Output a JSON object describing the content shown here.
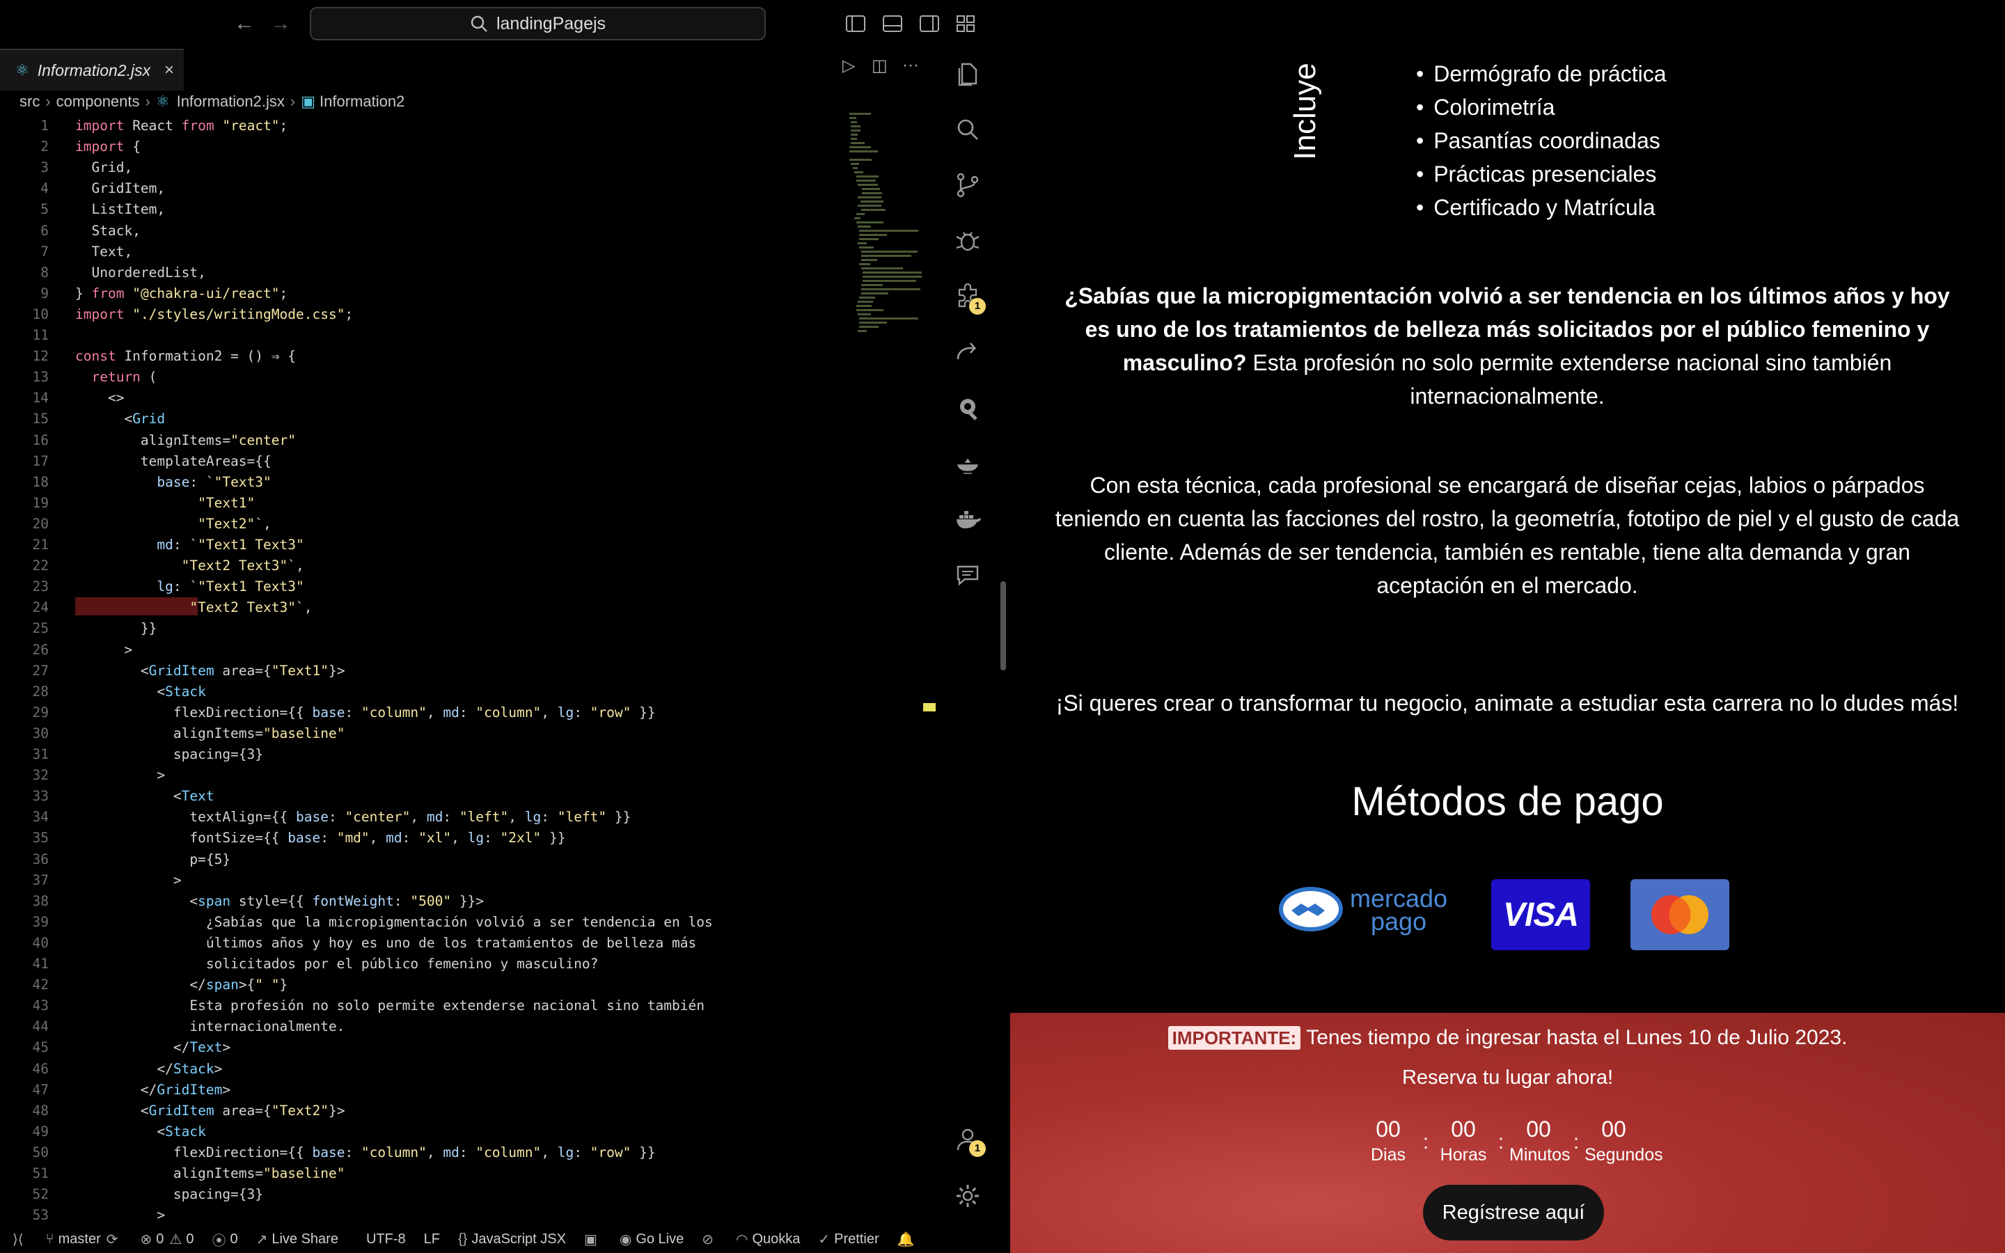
{
  "titlebar": {
    "search_text": "landingPagejs"
  },
  "tab": {
    "filename": "Information2.jsx"
  },
  "breadcrumb": {
    "src": "src",
    "components": "components",
    "file": "Information2.jsx",
    "symbol": "Information2"
  },
  "status": {
    "branch": "master",
    "errors": "0",
    "warnings": "0",
    "ports": "0",
    "live_share": "Live Share",
    "encoding": "UTF-8",
    "eol": "LF",
    "language": "JavaScript JSX",
    "go_live": "Go Live",
    "quokka": "Quokka",
    "prettier": "Prettier"
  },
  "activity": {
    "extensions_badge": "1",
    "accounts_badge": "1"
  },
  "code_lines": [
    "import React from \"react\";",
    "import {",
    "  Grid,",
    "  GridItem,",
    "  ListItem,",
    "  Stack,",
    "  Text,",
    "  UnorderedList,",
    "} from \"@chakra-ui/react\";",
    "import \"./styles/writingMode.css\";",
    "",
    "const Information2 = () ⇒ {",
    "  return (",
    "    <>",
    "      <Grid",
    "        alignItems=\"center\"",
    "        templateAreas={{",
    "          base: `\"Text3\"",
    "               \"Text1\"",
    "               \"Text2\"`,",
    "          md: `\"Text1 Text3\"",
    "             \"Text2 Text3\"`,",
    "          lg: `\"Text1 Text3\"",
    "              \"Text2 Text3\"`,",
    "        }}",
    "      >",
    "        <GridItem area={\"Text1\"}>",
    "          <Stack",
    "            flexDirection={{ base: \"column\", md: \"column\", lg: \"row\" }}",
    "            alignItems=\"baseline\"",
    "            spacing={3}",
    "          >",
    "            <Text",
    "              textAlign={{ base: \"center\", md: \"left\", lg: \"left\" }}",
    "              fontSize={{ base: \"md\", md: \"xl\", lg: \"2xl\" }}",
    "              p={5}",
    "            >",
    "              <span style={{ fontWeight: \"500\" }}>",
    "                ¿Sabías que la micropigmentación volvió a ser tendencia en los",
    "                últimos años y hoy es uno de los tratamientos de belleza más",
    "                solicitados por el público femenino y masculino?",
    "              </span>{\" \"}",
    "              Esta profesión no solo permite extenderse nacional sino también",
    "              internacionalmente.",
    "            </Text>",
    "          </Stack>",
    "        </GridItem>",
    "        <GridItem area={\"Text2\"}>",
    "          <Stack",
    "            flexDirection={{ base: \"column\", md: \"column\", lg: \"row\" }}",
    "            alignItems=\"baseline\"",
    "            spacing={3}",
    "          >"
  ],
  "preview": {
    "incluye_label": "Incluye",
    "incluye_items": [
      "Dermógrafo de práctica",
      "Colorimetría",
      "Pasantías coordinadas",
      "Prácticas presenciales",
      "Certificado y Matrícula"
    ],
    "para1_bold": "¿Sabías que la micropigmentación volvió a ser tendencia en los últimos años y hoy es uno de los tratamientos de belleza más solicitados por el público femenino y masculino?",
    "para1_rest": " Esta profesión no solo permite extenderse nacional sino también internacionalmente.",
    "para2": "Con esta técnica, cada profesional se encargará de diseñar cejas, labios o párpados teniendo en cuenta las facciones del rostro, la geometría, fototipo de piel y el gusto de cada cliente. Además de ser tendencia, también es rentable, tiene alta demanda y gran aceptación en el mercado.",
    "para3": "¡Si queres crear o transformar tu negocio, animate a estudiar esta carrera no lo dudes más!",
    "pagos_title": "Métodos de pago",
    "mp_line1": "mercado",
    "mp_line2": "pago",
    "visa": "VISA",
    "importante_tag": "IMPORTANTE:",
    "importante_text": "Tenes tiempo de ingresar hasta el Lunes 10 de Julio 2023.",
    "reserva": "Reserva tu lugar ahora!",
    "countdown": [
      {
        "value": "00",
        "label": "Dias"
      },
      {
        "value": "00",
        "label": "Horas"
      },
      {
        "value": "00",
        "label": "Minutos"
      },
      {
        "value": "00",
        "label": "Segundos"
      }
    ],
    "cta": "Regístrese aquí"
  }
}
